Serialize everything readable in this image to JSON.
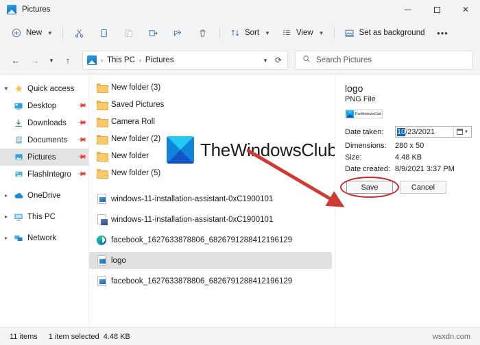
{
  "window": {
    "title": "Pictures",
    "icon": "pictures-folder-icon",
    "controls": {
      "minimize": "—",
      "maximize": "□",
      "close": "✕"
    }
  },
  "toolbar": {
    "new_label": "New",
    "sort_label": "Sort",
    "view_label": "View",
    "set_background_label": "Set as background",
    "more_label": "•••",
    "icons": [
      "cut-icon",
      "copy-icon",
      "paste-icon",
      "rename-icon",
      "share-icon",
      "delete-icon"
    ]
  },
  "nav": {
    "back": "←",
    "forward": "→",
    "recent": "⌄",
    "up": "↑",
    "breadcrumb": [
      "This PC",
      "Pictures"
    ],
    "separator": "›",
    "dropdown": "⌄",
    "refresh": "⟳"
  },
  "search": {
    "placeholder": "Search Pictures",
    "icon": "search-icon"
  },
  "sidebar": {
    "items": [
      {
        "label": "Quick access",
        "icon": "star-icon",
        "twisty": "⌄",
        "level": 0,
        "pinned": false,
        "selected": false
      },
      {
        "label": "Desktop",
        "icon": "desktop-icon",
        "twisty": "",
        "level": 1,
        "pinned": true,
        "selected": false
      },
      {
        "label": "Downloads",
        "icon": "downloads-icon",
        "twisty": "",
        "level": 1,
        "pinned": true,
        "selected": false
      },
      {
        "label": "Documents",
        "icon": "documents-icon",
        "twisty": "",
        "level": 1,
        "pinned": true,
        "selected": false
      },
      {
        "label": "Pictures",
        "icon": "pictures-icon",
        "twisty": "",
        "level": 1,
        "pinned": true,
        "selected": true
      },
      {
        "label": "FlashIntegro",
        "icon": "flashintegro-icon",
        "twisty": "",
        "level": 1,
        "pinned": true,
        "selected": false
      },
      {
        "label": "OneDrive",
        "icon": "onedrive-icon",
        "twisty": "›",
        "level": 0,
        "pinned": false,
        "selected": false
      },
      {
        "label": "This PC",
        "icon": "thispc-icon",
        "twisty": "›",
        "level": 0,
        "pinned": false,
        "selected": false
      },
      {
        "label": "Network",
        "icon": "network-icon",
        "twisty": "›",
        "level": 0,
        "pinned": false,
        "selected": false
      }
    ]
  },
  "files": [
    {
      "name": "New folder (3)",
      "type": "folder",
      "selected": false
    },
    {
      "name": "Saved Pictures",
      "type": "folder",
      "selected": false
    },
    {
      "name": "Camera Roll",
      "type": "folder",
      "selected": false
    },
    {
      "name": "New folder (2)",
      "type": "folder",
      "selected": false
    },
    {
      "name": "New folder",
      "type": "folder",
      "selected": false
    },
    {
      "name": "New folder (5)",
      "type": "folder",
      "selected": false
    },
    {
      "name": "windows-11-installation-assistant-0xC1900101",
      "type": "png",
      "selected": false
    },
    {
      "name": "windows-11-installation-assistant-0xC1900101",
      "type": "exe",
      "selected": false
    },
    {
      "name": "facebook_1627633878806_6826791288412196129",
      "type": "edge",
      "selected": false
    },
    {
      "name": "logo",
      "type": "png",
      "selected": true
    },
    {
      "name": "facebook_1627633878806_6826791288412196129",
      "type": "png",
      "selected": false
    }
  ],
  "watermark": {
    "text": "TheWindowsClub",
    "logo": "thewindowsclub-logo"
  },
  "properties": {
    "title": "logo",
    "subtitle": "PNG File",
    "thumbnail_text": "TheWindowsClub",
    "fields": [
      {
        "label": "Date taken:",
        "value": "10/23/2021",
        "editable": true
      },
      {
        "label": "Dimensions:",
        "value": "280 x 50",
        "editable": false
      },
      {
        "label": "Size:",
        "value": "4.48 KB",
        "editable": false
      },
      {
        "label": "Date created:",
        "value": "8/9/2021 3:37 PM",
        "editable": false
      }
    ],
    "date_selected_part": "10",
    "date_rest": "/23/2021",
    "save_label": "Save",
    "cancel_label": "Cancel"
  },
  "status": {
    "item_count": "11 items",
    "selection": "1 item selected",
    "selection_size": "4.48 KB",
    "watermark": "wsxdn.com"
  },
  "colors": {
    "accent": "#0067c0",
    "annotation_red": "#c9252b",
    "selection_blue": "#0a64c2",
    "window_bg": "#f3f3f3"
  }
}
